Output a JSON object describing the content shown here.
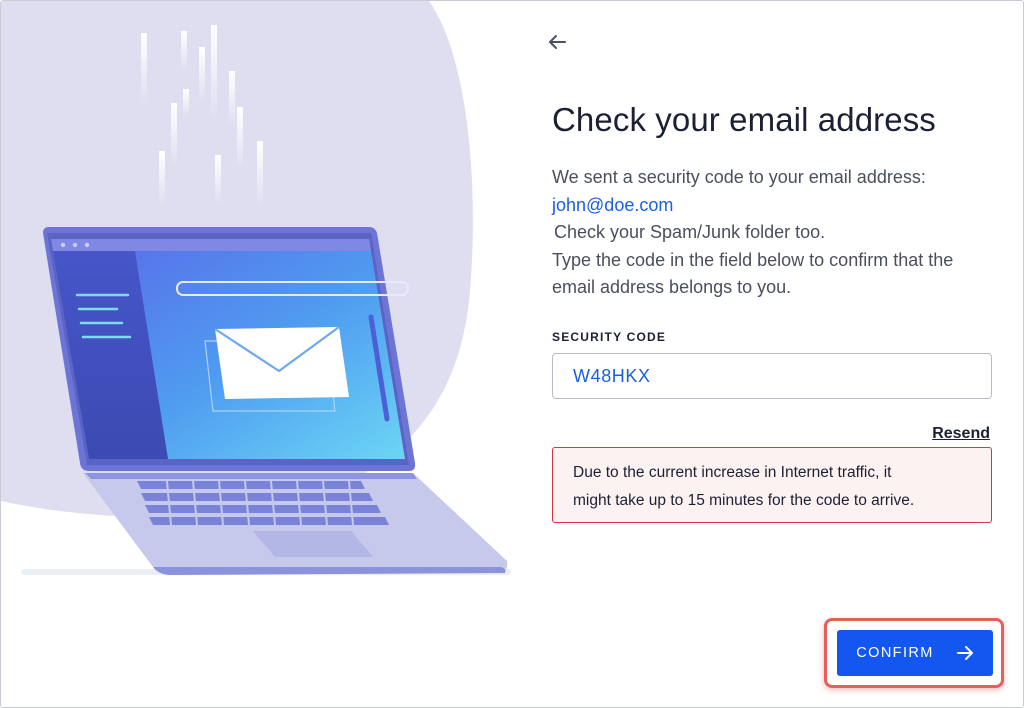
{
  "header": {
    "back_icon": "arrow-left-icon"
  },
  "page": {
    "title": "Check your email address"
  },
  "description": {
    "line1": "We sent a security code to your email address:",
    "email": "john@doe.com",
    "line2": "Check your Spam/Junk folder too.",
    "line3": "Type the code in the field below to confirm that the",
    "line4": "email address belongs to you."
  },
  "security_code": {
    "label": "SECURITY CODE",
    "value": "W48HKX"
  },
  "resend": {
    "label": "Resend"
  },
  "notice": {
    "line1": "Due to the current increase in Internet traffic, it",
    "line2": "might take up to 15 minutes for the code to arrive."
  },
  "confirm": {
    "label": "CONFIRM",
    "icon": "arrow-right-icon"
  },
  "illustration": {
    "name": "laptop-email-illustration",
    "icon": "envelope-icon"
  },
  "colors": {
    "accent": "#1456f0",
    "email_link": "#1a5fe0",
    "error_border": "#d63545",
    "error_bg": "#fdf2f2",
    "highlight": "#e65f5b",
    "blob": "#dedef0"
  }
}
